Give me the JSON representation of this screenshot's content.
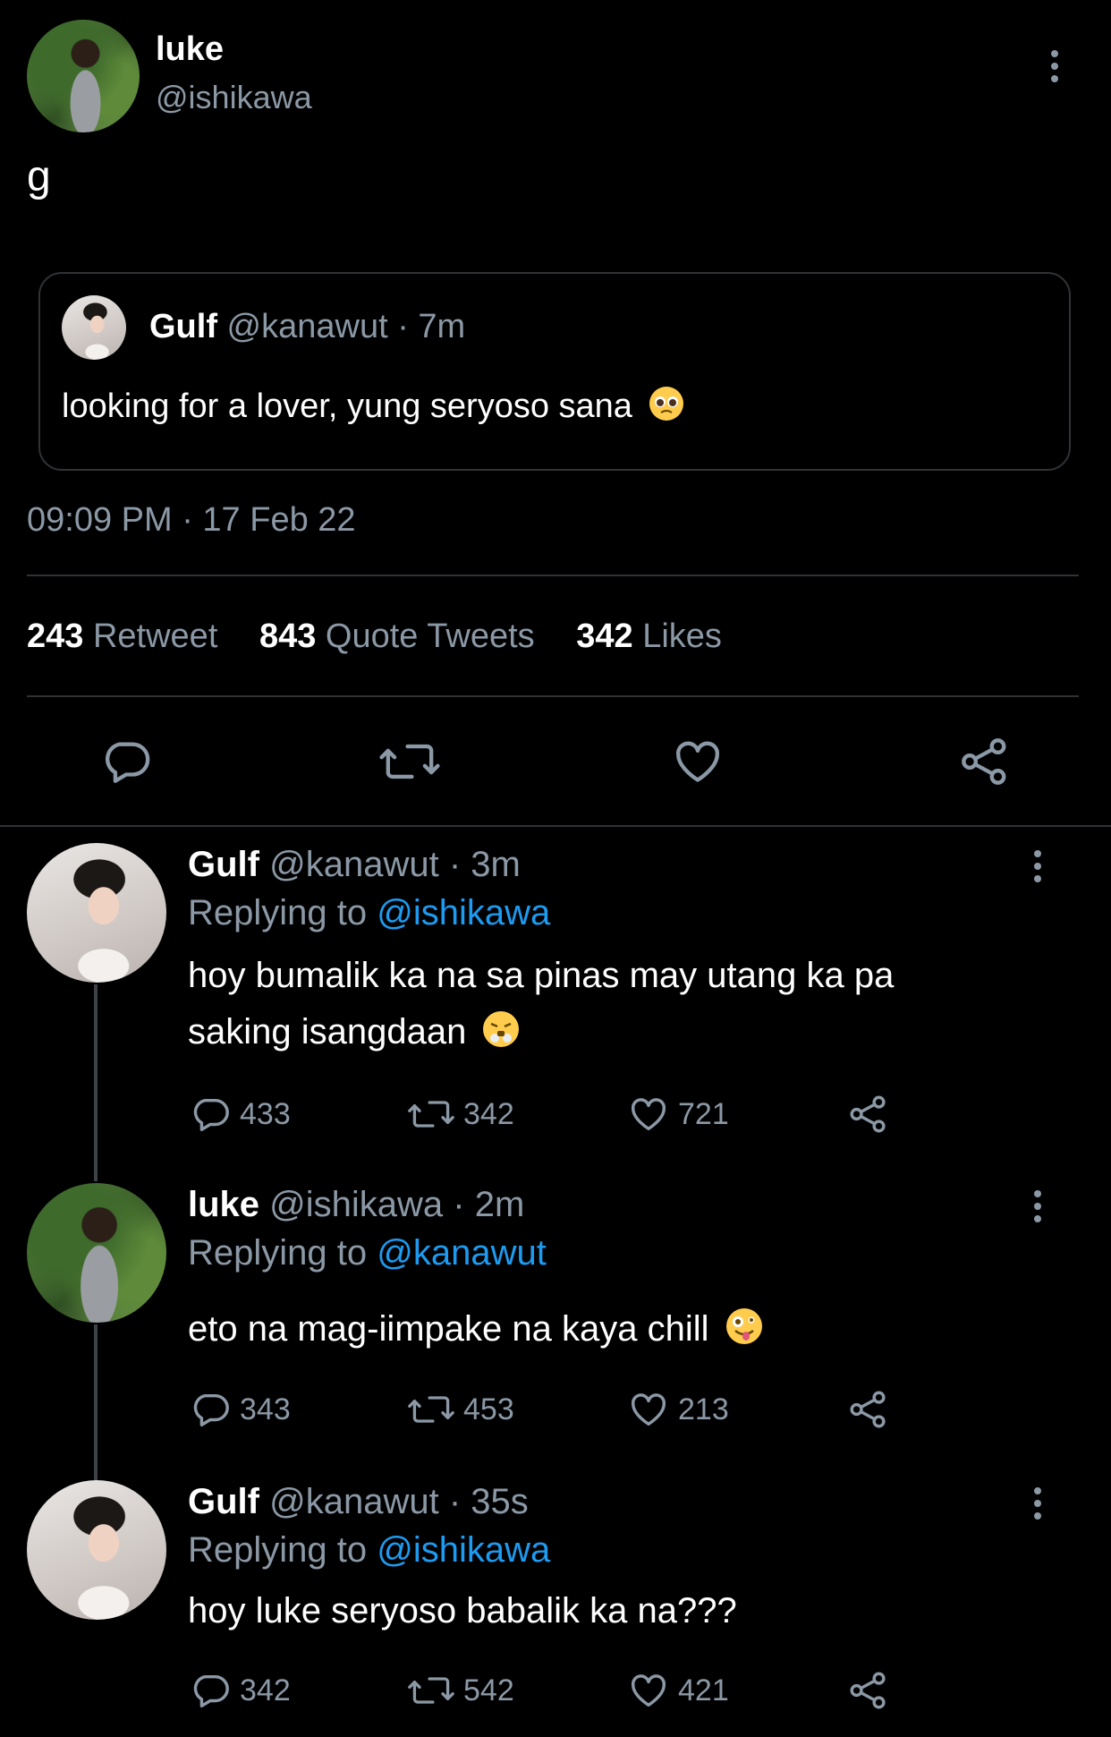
{
  "main_tweet": {
    "author_name": "luke",
    "author_handle": "@ishikawa",
    "text": "g",
    "timestamp": "09:09 PM · 17 Feb 22",
    "quoted": {
      "name": "Gulf",
      "meta": "@kanawut · 7m",
      "text": "looking for a lover, yung seryoso sana",
      "emoji": "pleading-face"
    },
    "stats": [
      {
        "count": "243",
        "label": "Retweet"
      },
      {
        "count": "843",
        "label": "Quote Tweets"
      },
      {
        "count": "342",
        "label": "Likes"
      }
    ],
    "actions": [
      "reply-icon",
      "retweet-icon",
      "like-icon",
      "share-icon"
    ]
  },
  "replies": [
    {
      "name": "Gulf",
      "meta": "@kanawut · 3m",
      "replying_label": "Replying to",
      "replying_to": "@ishikawa",
      "text_line1": "hoy bumalik ka na sa pinas may utang ka pa",
      "text_line2": "saking isangdaan",
      "emoji": "face-with-steam",
      "reply_count": "433",
      "retweet_count": "342",
      "like_count": "721"
    },
    {
      "name": "luke",
      "meta": "@ishikawa · 2m",
      "replying_label": "Replying to",
      "replying_to": "@kanawut",
      "text_line1": "eto na mag-iimpake na kaya chill",
      "emoji": "zany-face",
      "reply_count": "343",
      "retweet_count": "453",
      "like_count": "213"
    },
    {
      "name": "Gulf",
      "meta": "@kanawut · 35s",
      "replying_label": "Replying to",
      "replying_to": "@ishikawa",
      "text_line1": "hoy luke seryoso babalik ka na???",
      "reply_count": "342",
      "retweet_count": "542",
      "like_count": "421"
    }
  ],
  "colors": {
    "background": "#000000",
    "text": "#ffffff",
    "muted": "#8b98a5",
    "link": "#1d9bf0",
    "divider": "#2f3336"
  }
}
